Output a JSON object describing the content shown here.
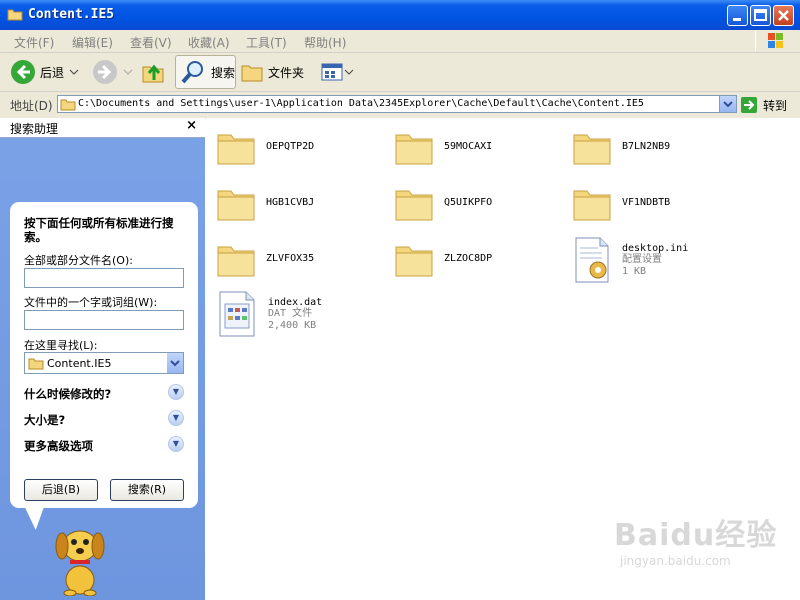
{
  "window": {
    "title": "Content.IE5"
  },
  "menu": [
    "文件(F)",
    "编辑(E)",
    "查看(V)",
    "收藏(A)",
    "工具(T)",
    "帮助(H)"
  ],
  "toolbar": {
    "back": "后退",
    "search": "搜索",
    "folders": "文件夹"
  },
  "address": {
    "label": "地址(D)",
    "path": "C:\\Documents and Settings\\user-1\\Application Data\\2345Explorer\\Cache\\Default\\Cache\\Content.IE5",
    "go": "转到"
  },
  "search_pane": {
    "title": "搜索助理",
    "close": "×",
    "question": "按下面任何或所有标准进行搜索。",
    "name_label": "全部或部分文件名(O):",
    "name_value": "",
    "word_label": "文件中的一个字或词组(W):",
    "word_value": "",
    "look_in_label": "在这里寻找(L):",
    "look_in_value": "Content.IE5",
    "options": [
      "什么时候修改的?",
      "大小是?",
      "更多高级选项"
    ],
    "back_button": "后退(B)",
    "search_button": "搜索(R)"
  },
  "files": [
    {
      "name": "OEPQTP2D",
      "type": "folder"
    },
    {
      "name": "59MOCAXI",
      "type": "folder"
    },
    {
      "name": "B7LN2NB9",
      "type": "folder"
    },
    {
      "name": "HGB1CVBJ",
      "type": "folder"
    },
    {
      "name": "Q5UIKPFO",
      "type": "folder"
    },
    {
      "name": "VF1NDBTB",
      "type": "folder"
    },
    {
      "name": "ZLVFOX35",
      "type": "folder"
    },
    {
      "name": "ZLZOC8DP",
      "type": "folder"
    },
    {
      "name": "desktop.ini",
      "type": "file",
      "kind": "配置设置",
      "size": "1 KB"
    },
    {
      "name": "index.dat",
      "type": "file",
      "kind": "DAT 文件",
      "size": "2,400 KB"
    }
  ],
  "watermark": {
    "brand": "Baidu经验",
    "url": "jingyan.baidu.com"
  },
  "colors": {
    "titlebar": "#0054e3",
    "pane": "#7aa1e6",
    "folder": "#f3d67d"
  }
}
